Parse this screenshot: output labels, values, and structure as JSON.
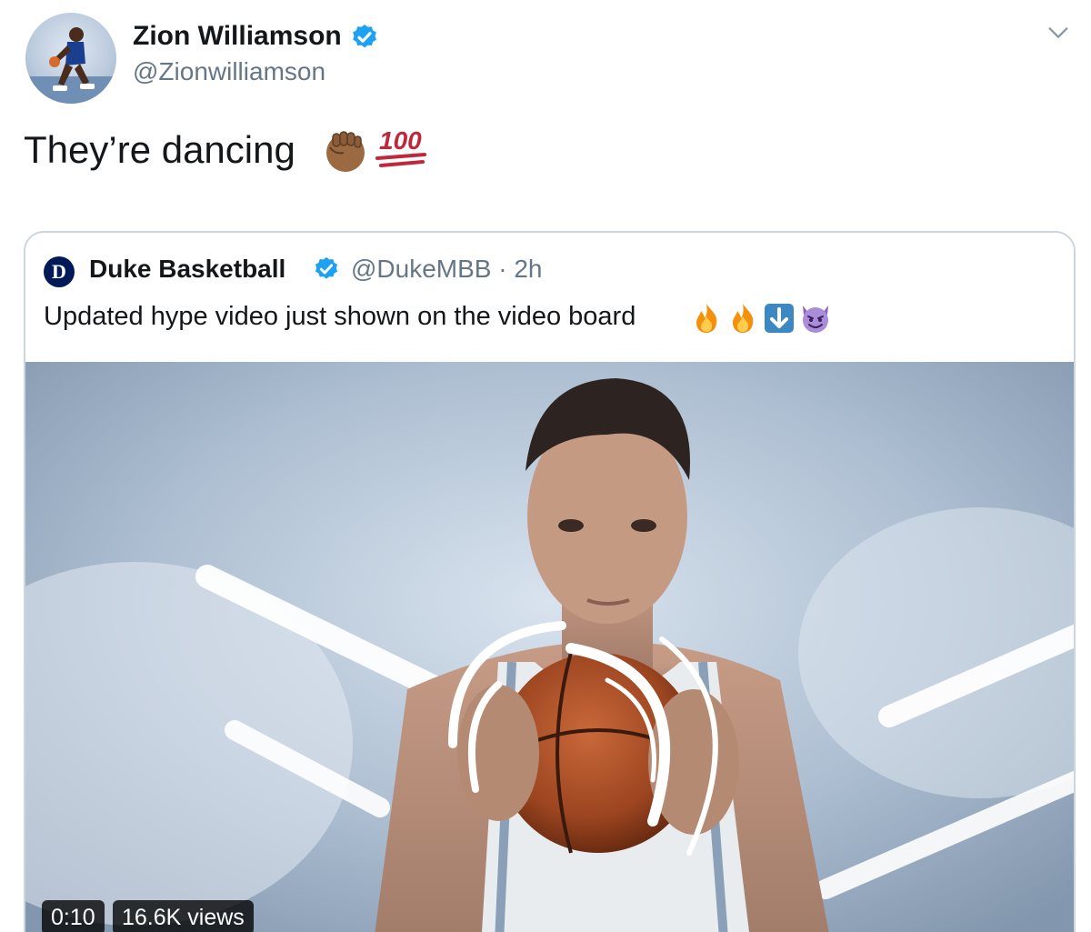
{
  "author": {
    "display_name": "Zion Williamson",
    "handle": "@Zionwilliamson",
    "verified": true
  },
  "tweet": {
    "text": "They’re dancing",
    "emojis": [
      "raised-fist-medium-dark-skin",
      "hundred-points"
    ]
  },
  "quoted_tweet": {
    "display_name": "Duke Basketball",
    "handle_and_time": "@DukeMBB · 2h",
    "avatar_letter": "D",
    "verified": true,
    "text": "Updated hype video just shown on the video board",
    "emojis": [
      "fire",
      "fire",
      "down-arrow",
      "smiling-devil"
    ],
    "video": {
      "duration": "0:10",
      "views": "16.6K views"
    }
  },
  "icons": {
    "verified": "verified-badge-icon",
    "menu": "chevron-down-icon"
  },
  "colors": {
    "verified_blue": "#1da1f2",
    "text_primary": "#14171a",
    "text_secondary": "#657786",
    "border": "#ccd6dd",
    "duke_navy": "#001a57"
  }
}
